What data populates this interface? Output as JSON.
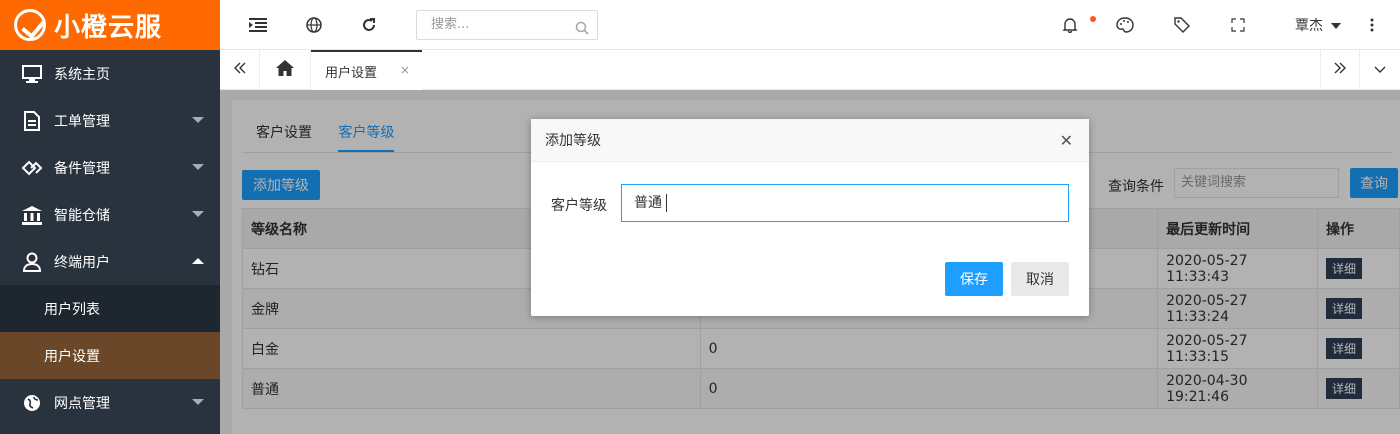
{
  "brand": {
    "name": "小橙云服",
    "color": "#fe6a01"
  },
  "sidebar": {
    "items": [
      {
        "label": "系统主页",
        "icon": "monitor-icon"
      },
      {
        "label": "工单管理",
        "icon": "document-icon"
      },
      {
        "label": "备件管理",
        "icon": "diamond-icon"
      },
      {
        "label": "智能仓储",
        "icon": "bank-icon"
      },
      {
        "label": "终端用户",
        "icon": "user-icon"
      },
      {
        "label": "网点管理",
        "icon": "globe-icon"
      }
    ],
    "subitems": [
      {
        "label": "用户列表"
      },
      {
        "label": "用户设置"
      }
    ]
  },
  "header": {
    "search_placeholder": "搜索...",
    "user_name": "覃杰"
  },
  "tabbar": {
    "active_tab": "用户设置",
    "close_glyph": "×"
  },
  "content": {
    "tabs": [
      "客户设置",
      "客户等级"
    ],
    "add_button": "添加等级",
    "query_label": "查询条件",
    "query_placeholder": "关键词搜索",
    "query_button": "查询",
    "table": {
      "headers": [
        "等级名称",
        "",
        "最后更新时间",
        "操作"
      ],
      "rows": [
        {
          "name": "钻石",
          "value": "",
          "updated": "2020-05-27 11:33:43",
          "action": "详细"
        },
        {
          "name": "金牌",
          "value": "",
          "updated": "2020-05-27 11:33:24",
          "action": "详细"
        },
        {
          "name": "白金",
          "value": "0",
          "updated": "2020-05-27 11:33:15",
          "action": "详细"
        },
        {
          "name": "普通",
          "value": "0",
          "updated": "2020-04-30 19:21:46",
          "action": "详细"
        }
      ]
    }
  },
  "modal": {
    "title": "添加等级",
    "field_label": "客户等级",
    "field_value": "普通",
    "save_label": "保存",
    "cancel_label": "取消",
    "close_glyph": "✕"
  }
}
